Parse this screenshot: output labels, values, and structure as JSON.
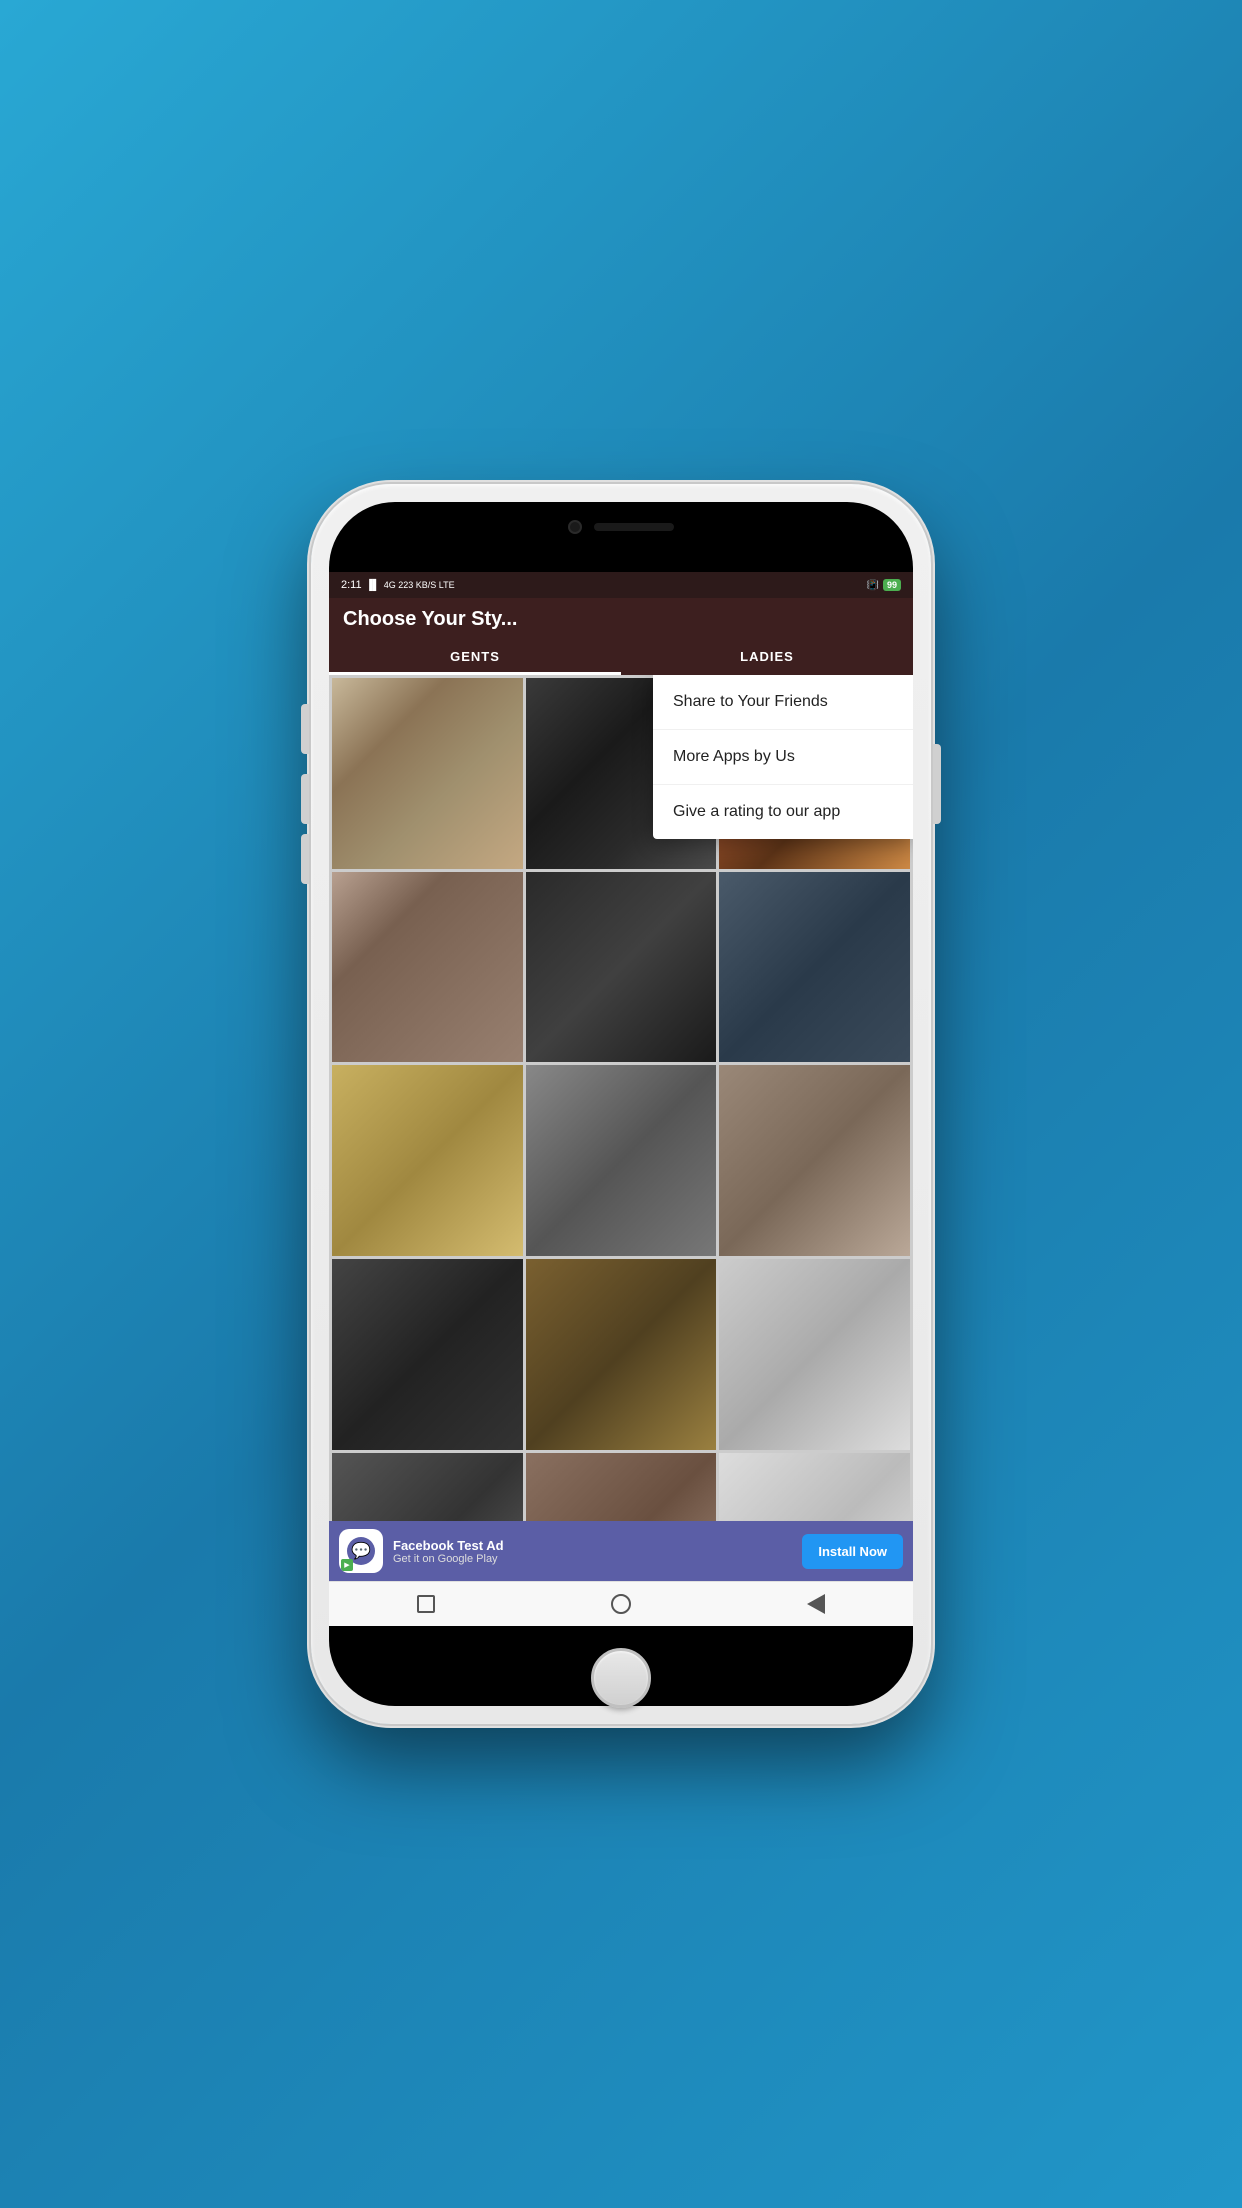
{
  "phone": {
    "status_bar": {
      "time": "2:11",
      "signal_info": "4G 223 KB/S LTE",
      "battery": "99"
    },
    "app_header": {
      "title": "Choose Your Sty..."
    },
    "tabs": [
      {
        "label": "GENTS",
        "active": true
      },
      {
        "label": "LADIES",
        "active": false
      }
    ],
    "dropdown_menu": {
      "items": [
        {
          "label": "Share to Your Friends"
        },
        {
          "label": "More Apps by Us"
        },
        {
          "label": "Give a rating to our app"
        }
      ]
    },
    "grid": {
      "cells": [
        {
          "id": 1
        },
        {
          "id": 2
        },
        {
          "id": 3
        },
        {
          "id": 4
        },
        {
          "id": 5
        },
        {
          "id": 6
        },
        {
          "id": 7
        },
        {
          "id": 8
        },
        {
          "id": 9
        },
        {
          "id": 10
        },
        {
          "id": 11
        },
        {
          "id": 12
        },
        {
          "id": 13
        },
        {
          "id": 14
        },
        {
          "id": 15
        }
      ]
    },
    "ad": {
      "title": "Facebook Test Ad",
      "subtitle": "Get it on Google Play",
      "install_label": "Install Now"
    },
    "bottom_nav": {
      "square_label": "recents",
      "circle_label": "home",
      "triangle_label": "back"
    }
  }
}
